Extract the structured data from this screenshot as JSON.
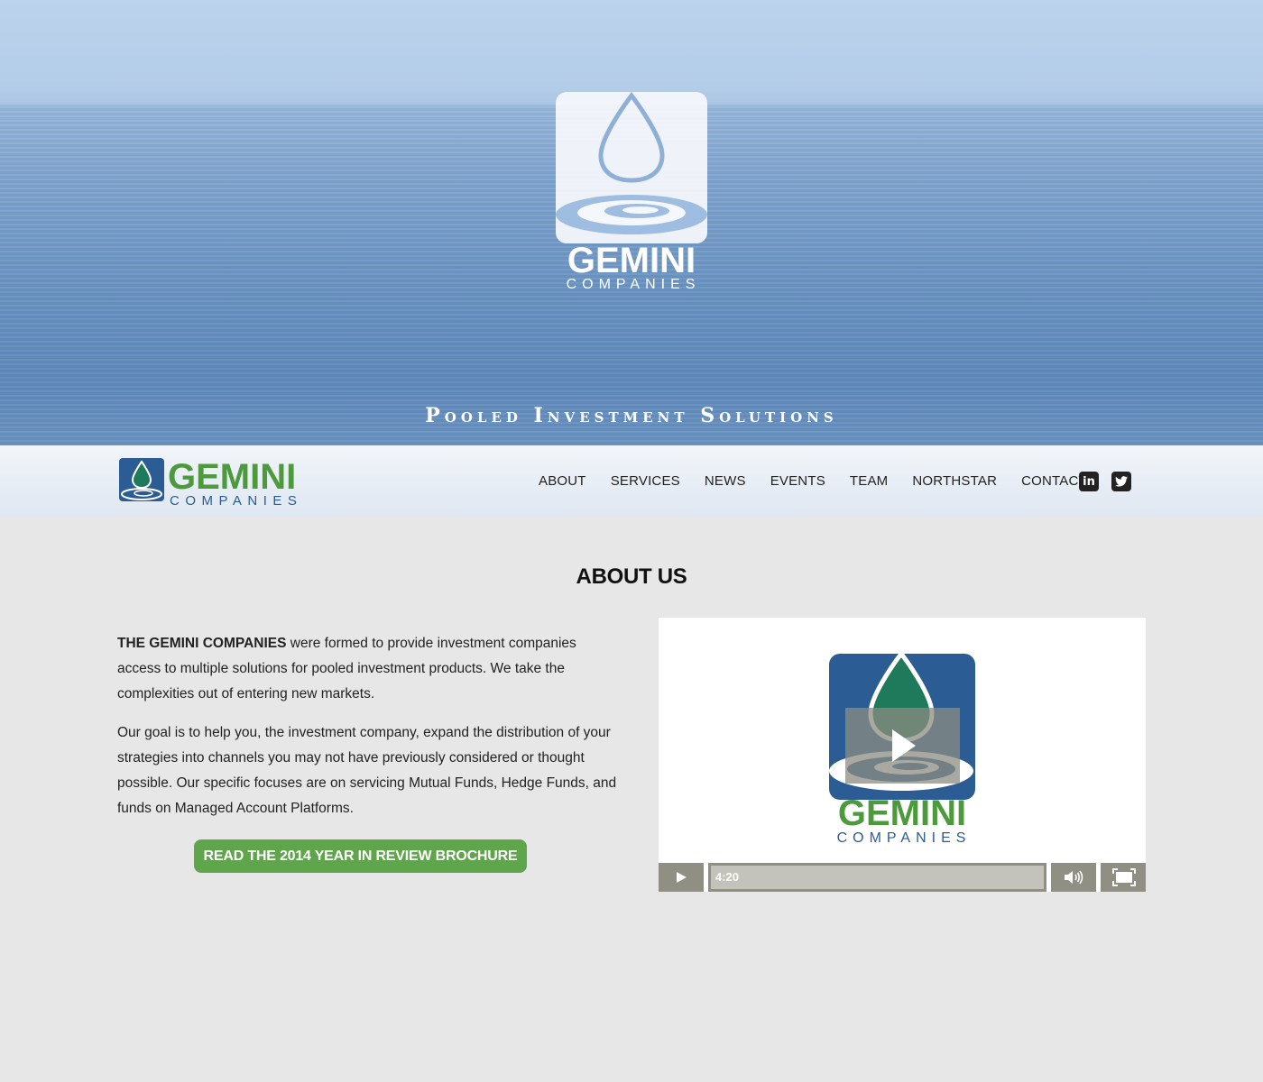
{
  "hero": {
    "logo_wordmark": "GEMINI",
    "logo_subtitle": "COMPANIES",
    "tagline": "Pooled Investment Solutions"
  },
  "navbar": {
    "brand_wordmark": "GEMINI",
    "brand_subtitle": "COMPANIES",
    "links": [
      "ABOUT",
      "SERVICES",
      "NEWS",
      "EVENTS",
      "TEAM",
      "NORTHSTAR",
      "CONTACT"
    ],
    "social": [
      {
        "icon": "linkedin-icon",
        "glyph": "in"
      },
      {
        "icon": "twitter-icon",
        "glyph": ""
      }
    ]
  },
  "about": {
    "heading": "ABOUT US",
    "para1_bold": "THE GEMINI COMPANIES",
    "para1_rest": " were formed to provide investment companies access to multiple solutions for pooled investment products. We take the complexities out of entering new markets.",
    "para2": "Our goal is to help you, the investment company, expand the distribution of your strategies into channels you may not have previously considered or thought possible. Our specific focuses are on servicing Mutual Funds, Hedge Funds, and funds on Managed Account Platforms.",
    "cta_label": "READ THE 2014 YEAR IN REVIEW BROCHURE"
  },
  "video": {
    "logo_wordmark": "GEMINI",
    "logo_subtitle": "COMPANIES",
    "duration": "4:20"
  },
  "colors": {
    "brand_green": "#5fa54c",
    "brand_blue": "#2b5c93",
    "drop_green": "#1f7a5c"
  }
}
